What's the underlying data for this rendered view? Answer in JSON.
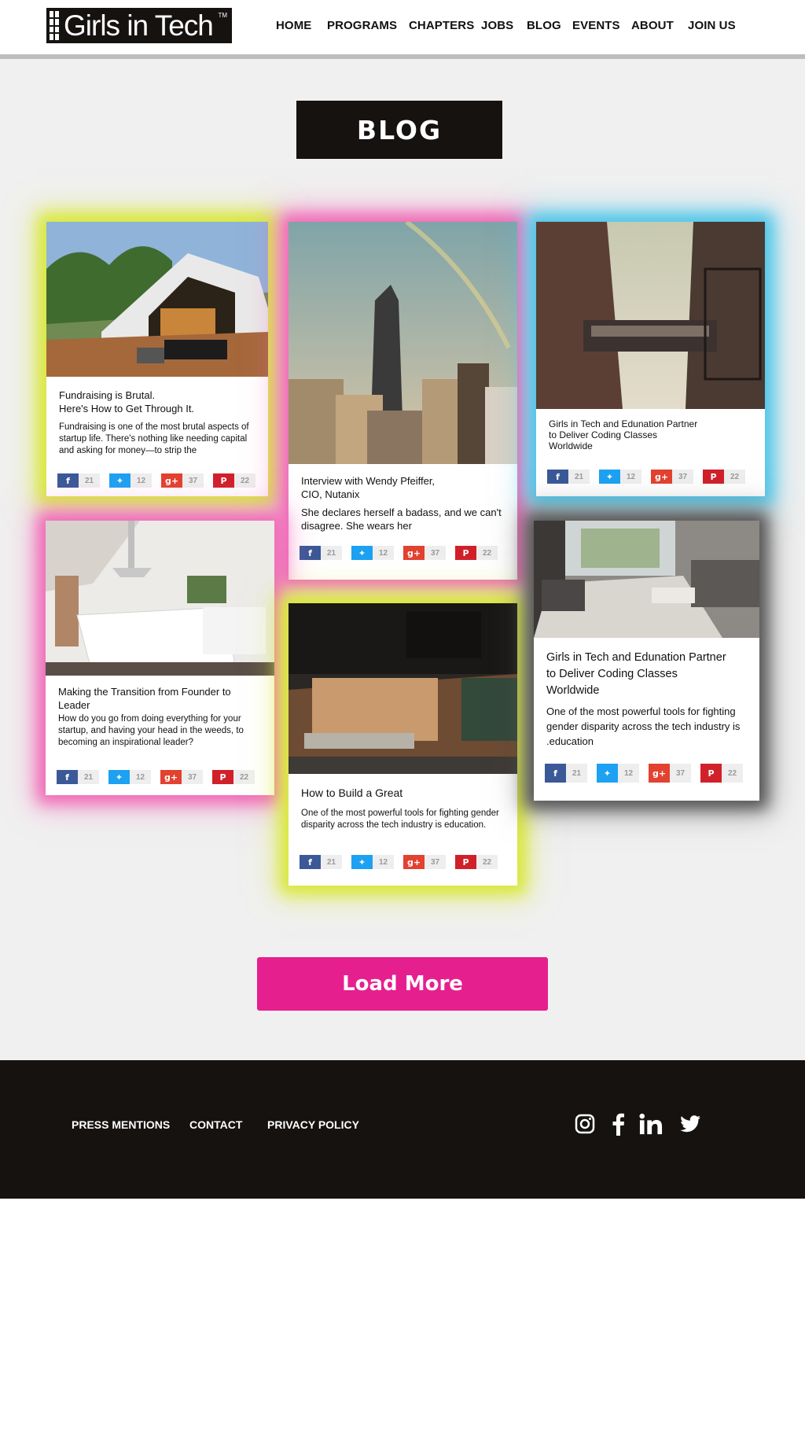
{
  "header": {
    "logo_text": "Girls in Tech",
    "logo_tm": "TM",
    "nav": [
      "HOME",
      "PROGRAMS",
      "CHAPTERS",
      "JOBS",
      "BLOG",
      "EVENTS",
      "ABOUT",
      "JOIN US"
    ]
  },
  "main": {
    "title": "BLOG",
    "share_counts": {
      "facebook": "21",
      "twitter": "12",
      "googleplus": "37",
      "pinterest": "22"
    },
    "cards": [
      {
        "title": "Fundraising is Brutal.\nHere's How to Get Through It.",
        "excerpt": "Fundraising is one of the most brutal aspects of startup life. There's nothing like needing capital and asking for money—to strip the",
        "glow": "#d9e83a"
      },
      {
        "title": "Interview with Wendy Pfeiffer,\nCIO, Nutanix",
        "excerpt": "She declares herself a badass, and we can't disagree. She wears her",
        "glow": "#f06bb8"
      },
      {
        "title": "Girls in Tech and Edunation Partner\nto Deliver Coding Classes\nWorldwide",
        "excerpt": "",
        "glow": "#4fc6e8"
      },
      {
        "title": "Making the Transition from Founder to Leader",
        "excerpt": "How do you go from doing everything for your startup, and having your head in the weeds, to becoming an inspirational leader?",
        "glow": "#f06bb8"
      },
      {
        "title": "How to Build a Great",
        "excerpt": "One of the most powerful tools for fighting gender disparity across the tech industry is education.",
        "glow": "#d9e83a"
      },
      {
        "title": "Girls in Tech and Edunation Partner\nto Deliver Coding Classes\nWorldwide",
        "excerpt": "One of the most powerful tools for fighting gender disparity across the tech industry is .education",
        "glow": "#555555"
      }
    ],
    "load_more_label": "Load More"
  },
  "footer": {
    "links": [
      "PRESS MENTIONS",
      "CONTACT",
      "PRIVACY POLICY"
    ],
    "social_icons": [
      "instagram-icon",
      "facebook-icon",
      "linkedin-icon",
      "twitter-icon"
    ]
  },
  "colors": {
    "brand_dark": "#151210",
    "accent_pink": "#e61f8f",
    "glow_yellow": "#d9e83a",
    "glow_pink": "#f06bb8",
    "glow_blue": "#4fc6e8"
  }
}
